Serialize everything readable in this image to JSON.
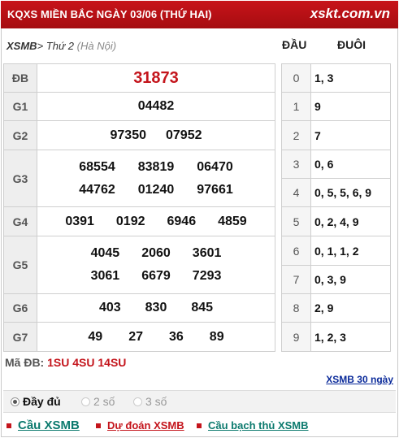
{
  "header": {
    "title": "KQXS MIỀN BẮC NGÀY 03/06 (THỨ HAI)",
    "brand": "xskt.com.vn"
  },
  "subheader": {
    "crumb_root": "XSMB",
    "crumb_sep": ">",
    "crumb_day": "Thứ 2",
    "crumb_loc": "(Hà Nội)",
    "col_dau": "ĐẦU",
    "col_duoi": "ĐUÔI"
  },
  "prizes": [
    {
      "label": "ĐB",
      "lines": [
        [
          "31873"
        ]
      ]
    },
    {
      "label": "G1",
      "lines": [
        [
          "04482"
        ]
      ]
    },
    {
      "label": "G2",
      "lines": [
        [
          "97350",
          "07952"
        ]
      ]
    },
    {
      "label": "G3",
      "lines": [
        [
          "68554",
          "83819",
          "06470"
        ],
        [
          "44762",
          "01240",
          "97661"
        ]
      ]
    },
    {
      "label": "G4",
      "lines": [
        [
          "0391",
          "0192",
          "6946",
          "4859"
        ]
      ]
    },
    {
      "label": "G5",
      "lines": [
        [
          "4045",
          "2060",
          "3601"
        ],
        [
          "3061",
          "6679",
          "7293"
        ]
      ]
    },
    {
      "label": "G6",
      "lines": [
        [
          "403",
          "830",
          "845"
        ]
      ]
    },
    {
      "label": "G7",
      "lines": [
        [
          "49",
          "27",
          "36",
          "89"
        ]
      ]
    }
  ],
  "loto": [
    {
      "dau": "0",
      "duoi": "1, 3"
    },
    {
      "dau": "1",
      "duoi": "9"
    },
    {
      "dau": "2",
      "duoi": "7"
    },
    {
      "dau": "3",
      "duoi": "0, 6"
    },
    {
      "dau": "4",
      "duoi": "0, 5, 5, 6, 9"
    },
    {
      "dau": "5",
      "duoi": "0, 2, 4, 9"
    },
    {
      "dau": "6",
      "duoi": "0, 1, 1, 2"
    },
    {
      "dau": "7",
      "duoi": "0, 3, 9"
    },
    {
      "dau": "8",
      "duoi": "2, 9"
    },
    {
      "dau": "9",
      "duoi": "1, 2, 3"
    }
  ],
  "ma_db": {
    "label": "Mã ĐB:",
    "value": "1SU 4SU 14SU"
  },
  "link_30": "XSMB 30 ngày",
  "options": [
    {
      "label": "Đầy đủ",
      "selected": true
    },
    {
      "label": "2 số",
      "selected": false
    },
    {
      "label": "3 số",
      "selected": false
    }
  ],
  "links": [
    {
      "label": "Cầu XSMB",
      "color": "#0c7a6e"
    },
    {
      "label": "Dự đoán XSMB",
      "color": "#c4151c"
    },
    {
      "label": "Cầu bạch thủ XSMB",
      "color": "#0c7a6e"
    }
  ],
  "colors": {
    "header_bg": "#b3101a",
    "accent_red": "#c4151c",
    "link_blue": "#0a2a9a",
    "link_teal": "#0c7a6e"
  }
}
